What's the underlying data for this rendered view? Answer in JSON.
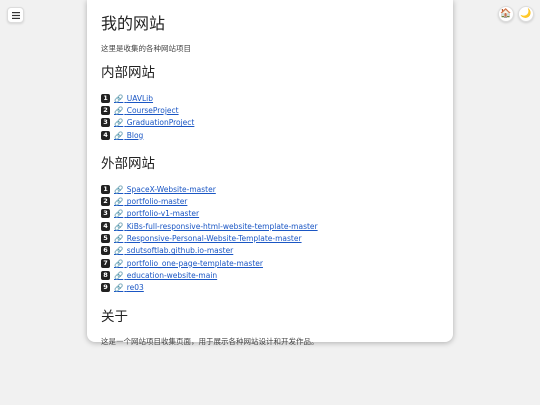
{
  "header": {
    "menu_icon": "hamburger-icon",
    "home_icon": "🏠",
    "theme_icon": "🌙"
  },
  "main": {
    "title": "我的网站",
    "subtitle": "这里是收集的各种网站项目",
    "internal": {
      "heading": "内部网站",
      "items": [
        {
          "num": "1",
          "icon": "🔗",
          "label": "UAVLib"
        },
        {
          "num": "2",
          "icon": "🔗",
          "label": "CourseProject"
        },
        {
          "num": "3",
          "icon": "🔗",
          "label": "GraduationProject"
        },
        {
          "num": "4",
          "icon": "🔗",
          "label": "Blog"
        }
      ]
    },
    "external": {
      "heading": "外部网站",
      "items": [
        {
          "num": "1",
          "icon": "🔗",
          "label": "SpaceX-Website-master"
        },
        {
          "num": "2",
          "icon": "🔗",
          "label": "portfolio-master"
        },
        {
          "num": "3",
          "icon": "🔗",
          "label": "portfolio-v1-master"
        },
        {
          "num": "4",
          "icon": "🔗",
          "label": "KiBs-full-responsive-html-website-template-master"
        },
        {
          "num": "5",
          "icon": "🔗",
          "label": "Responsive-Personal-Website-Template-master"
        },
        {
          "num": "6",
          "icon": "🔗",
          "label": "sdutsoftlab.github.io-master"
        },
        {
          "num": "7",
          "icon": "🔗",
          "label": "portfolio_one-page-template-master"
        },
        {
          "num": "8",
          "icon": "🔗",
          "label": "education-website-main"
        },
        {
          "num": "9",
          "icon": "🔗",
          "label": "re03"
        }
      ]
    },
    "about": {
      "heading": "关于",
      "text": "这是一个网站项目收集页面，用于展示各种网站设计和开发作品。"
    }
  }
}
